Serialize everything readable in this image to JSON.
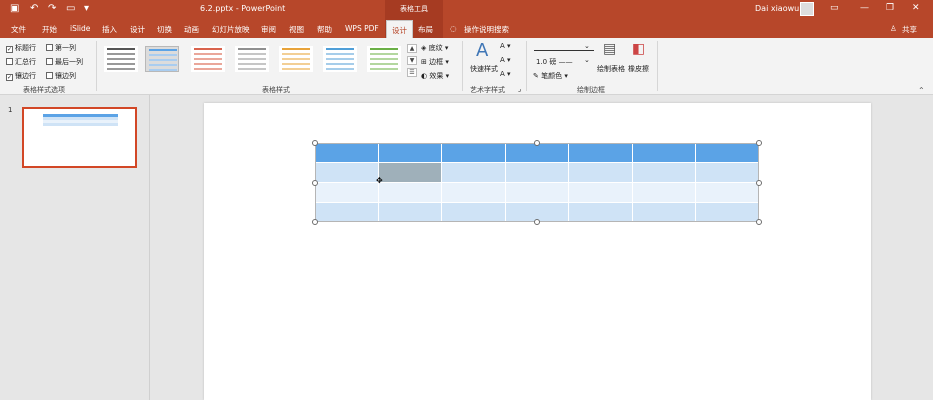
{
  "titlebar": {
    "doc_title": "6.2.pptx - PowerPoint",
    "context_title": "表格工具",
    "user": "Dai xiaowu",
    "icons": [
      "save-icon",
      "undo-icon",
      "redo-icon",
      "start-presentation-icon",
      "customize-icon"
    ]
  },
  "tabs": [
    {
      "label": "文件"
    },
    {
      "label": "开始"
    },
    {
      "label": "iSlide"
    },
    {
      "label": "插入"
    },
    {
      "label": "设计"
    },
    {
      "label": "切换"
    },
    {
      "label": "动画"
    },
    {
      "label": "幻灯片放映"
    },
    {
      "label": "审阅"
    },
    {
      "label": "视图"
    },
    {
      "label": "帮助"
    },
    {
      "label": "WPS PDF"
    },
    {
      "label": "设计"
    },
    {
      "label": "布局"
    }
  ],
  "tell_me": "操作说明搜索",
  "share": "共享",
  "ribbon": {
    "options": {
      "header_row": "标题行",
      "first_column": "第一列",
      "total_row": "汇总行",
      "last_column": "最后一列",
      "banded_rows": "镶边行",
      "banded_columns": "镶边列",
      "group_label": "表格样式选项"
    },
    "styles": {
      "group_label": "表格样式",
      "shading": "底纹",
      "border": "边框",
      "effects": "效果"
    },
    "wordart": {
      "quick_styles": "快速样式",
      "group_label": "艺术字样式"
    },
    "draw": {
      "pen_weight": "1.0 磅",
      "pen_color": "笔颜色",
      "draw_table": "绘制表格",
      "eraser": "橡皮擦",
      "group_label": "绘制边框"
    }
  },
  "thumbnail": {
    "number": "1"
  },
  "colors": {
    "accent": "#b7472a",
    "header_blue": "#5ba3e6",
    "band_light": "#cfe3f6",
    "band_lighter": "#e9f2fb",
    "selected_cell": "#9fb0ba"
  }
}
